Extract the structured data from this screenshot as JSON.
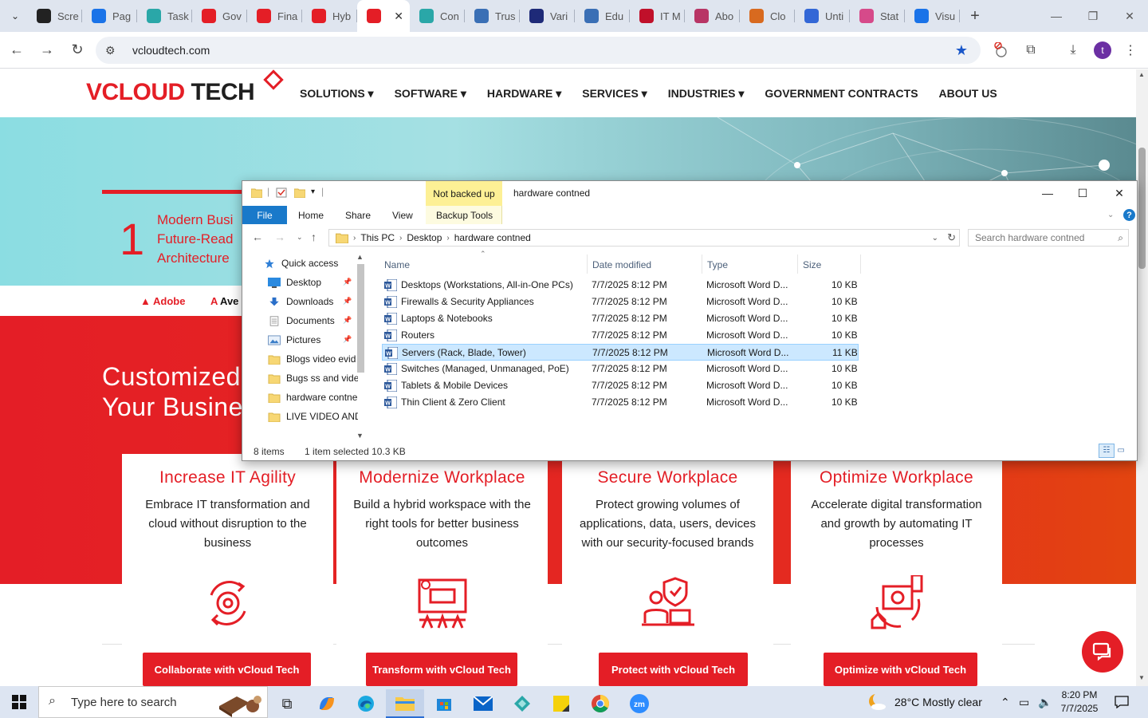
{
  "browser": {
    "tabs": [
      {
        "label": "Scre",
        "color": "#222222"
      },
      {
        "label": "Pag",
        "color": "#1a73e8"
      },
      {
        "label": "Task",
        "color": "#2aa7a8"
      },
      {
        "label": "Gov",
        "color": "#e41e26"
      },
      {
        "label": "Fina",
        "color": "#e41e26"
      },
      {
        "label": "Hyb",
        "color": "#e41e26"
      },
      {
        "label": "",
        "color": "#e41e26"
      },
      {
        "label": "Con",
        "color": "#2aa7a8"
      },
      {
        "label": "Trus",
        "color": "#3a6fb5"
      },
      {
        "label": "Vari",
        "color": "#1e2a78"
      },
      {
        "label": "Edu",
        "color": "#3a6fb5"
      },
      {
        "label": "IT M",
        "color": "#c0102a"
      },
      {
        "label": "Abo",
        "color": "#b83565"
      },
      {
        "label": "Clo",
        "color": "#d86a1f"
      },
      {
        "label": "Unti",
        "color": "#3367d6"
      },
      {
        "label": "Stat",
        "color": "#d64a8a"
      },
      {
        "label": "Visu",
        "color": "#1a73e8"
      }
    ],
    "url": "vcloudtech.com",
    "profile_initial": "t"
  },
  "site": {
    "logo_red": "V",
    "logo_cloud": "CLOUD",
    "logo_tech": " TECH",
    "nav": [
      "SOLUTIONS",
      "SOFTWARE",
      "HARDWARE",
      "SERVICES",
      "INDUSTRIES",
      "GOVERNMENT CONTRACTS",
      "ABOUT US"
    ],
    "nav_dropdown": [
      true,
      true,
      true,
      true,
      true,
      false,
      false
    ],
    "hero_number": "1",
    "hero_lines": [
      "Modern Busi",
      "Future-Read",
      "Architecture"
    ],
    "brands": [
      "Adobe",
      "Ave"
    ],
    "custom_title_1": "Customized",
    "custom_title_2": "Your Busine",
    "cards": [
      {
        "title": "Increase IT Agility",
        "text": "Embrace IT transformation and cloud without disruption to the business",
        "cta": "Collaborate with vCloud Tech",
        "icon": "gear-cycle-icon"
      },
      {
        "title": "Modernize Workplace",
        "text": "Build a hybrid workspace with the right tools for better business outcomes",
        "cta": "Transform with vCloud Tech",
        "icon": "workspace-icon"
      },
      {
        "title": "Secure Workplace",
        "text": "Protect growing volumes of applications, data, users, devices with our security-focused brands",
        "cta": "Protect with vCloud Tech",
        "icon": "secure-worker-icon"
      },
      {
        "title": "Optimize Workplace",
        "text": "Accelerate digital transformation and growth by automating IT processes",
        "cta": "Optimize with vCloud Tech",
        "icon": "automation-icon"
      }
    ]
  },
  "explorer": {
    "not_backed_up": "Not backed up",
    "title": "hardware contned",
    "ribbon": {
      "file": "File",
      "home": "Home",
      "share": "Share",
      "view": "View",
      "backup": "Backup Tools"
    },
    "breadcrumbs": [
      "This PC",
      "Desktop",
      "hardware contned"
    ],
    "search_placeholder": "Search hardware contned",
    "nav_items": [
      {
        "label": "Quick access",
        "icon": "star-icon",
        "pinned": false
      },
      {
        "label": "Desktop",
        "icon": "desktop-icon",
        "pinned": true
      },
      {
        "label": "Downloads",
        "icon": "download-icon",
        "pinned": true
      },
      {
        "label": "Documents",
        "icon": "documents-icon",
        "pinned": true
      },
      {
        "label": "Pictures",
        "icon": "pictures-icon",
        "pinned": true
      },
      {
        "label": "Blogs video evid",
        "icon": "folder-icon",
        "pinned": false
      },
      {
        "label": "Bugs ss and  vide",
        "icon": "folder-icon",
        "pinned": false
      },
      {
        "label": "hardware contne",
        "icon": "folder-icon",
        "pinned": false
      },
      {
        "label": "LIVE VIDEO AND",
        "icon": "folder-icon",
        "pinned": false
      }
    ],
    "columns": [
      "Name",
      "Date modified",
      "Type",
      "Size"
    ],
    "files": [
      {
        "name": "Desktops (Workstations, All-in-One PCs)",
        "date": "7/7/2025 8:12 PM",
        "type": "Microsoft Word D...",
        "size": "10 KB",
        "selected": false
      },
      {
        "name": "Firewalls & Security Appliances",
        "date": "7/7/2025 8:12 PM",
        "type": "Microsoft Word D...",
        "size": "10 KB",
        "selected": false
      },
      {
        "name": "Laptops & Notebooks",
        "date": "7/7/2025 8:12 PM",
        "type": "Microsoft Word D...",
        "size": "10 KB",
        "selected": false
      },
      {
        "name": "Routers",
        "date": "7/7/2025 8:12 PM",
        "type": "Microsoft Word D...",
        "size": "10 KB",
        "selected": false
      },
      {
        "name": "Servers (Rack, Blade, Tower)",
        "date": "7/7/2025 8:12 PM",
        "type": "Microsoft Word D...",
        "size": "11 KB",
        "selected": true
      },
      {
        "name": "Switches (Managed, Unmanaged, PoE)",
        "date": "7/7/2025 8:12 PM",
        "type": "Microsoft Word D...",
        "size": "10 KB",
        "selected": false
      },
      {
        "name": "Tablets & Mobile Devices",
        "date": "7/7/2025 8:12 PM",
        "type": "Microsoft Word D...",
        "size": "10 KB",
        "selected": false
      },
      {
        "name": "Thin Client & Zero Client",
        "date": "7/7/2025 8:12 PM",
        "type": "Microsoft Word D...",
        "size": "10 KB",
        "selected": false
      }
    ],
    "status_items": "8 items",
    "status_selected": "1 item selected  10.3 KB"
  },
  "taskbar": {
    "search_placeholder": "Type here to search",
    "weather": "28°C  Mostly clear",
    "time": "8:20 PM",
    "date": "7/7/2025"
  },
  "colors": {
    "brand_red": "#e41e26",
    "explorer_blue": "#1979ca",
    "selection": "#cce8ff"
  }
}
